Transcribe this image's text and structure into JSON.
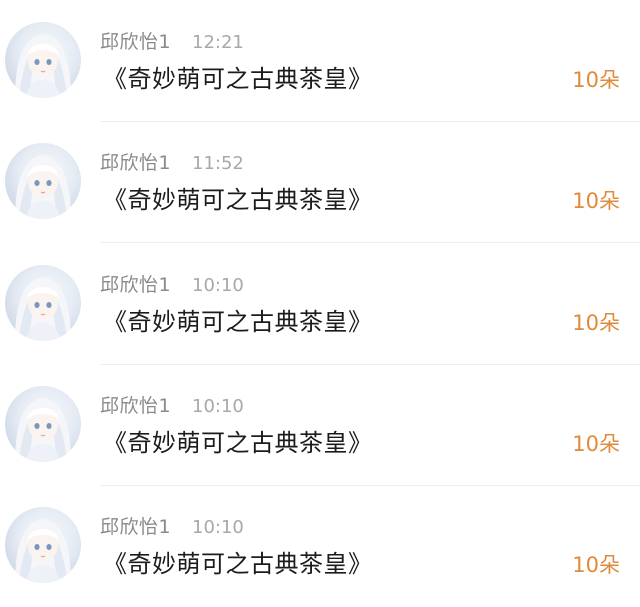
{
  "colors": {
    "name": "#8a8a8a",
    "time": "#a8a8a8",
    "title": "#1c1c1c",
    "amount": "#e08a3a",
    "divider": "#eeeeee"
  },
  "items": [
    {
      "avatar_icon": "anime-girl-avatar",
      "name": "邱欣怡1",
      "time": "12:21",
      "title": "《奇妙萌可之古典茶皇》",
      "amount": "10朵"
    },
    {
      "avatar_icon": "anime-girl-avatar",
      "name": "邱欣怡1",
      "time": "11:52",
      "title": "《奇妙萌可之古典茶皇》",
      "amount": "10朵"
    },
    {
      "avatar_icon": "anime-girl-avatar",
      "name": "邱欣怡1",
      "time": "10:10",
      "title": "《奇妙萌可之古典茶皇》",
      "amount": "10朵"
    },
    {
      "avatar_icon": "anime-girl-avatar",
      "name": "邱欣怡1",
      "time": "10:10",
      "title": "《奇妙萌可之古典茶皇》",
      "amount": "10朵"
    },
    {
      "avatar_icon": "anime-girl-avatar",
      "name": "邱欣怡1",
      "time": "10:10",
      "title": "《奇妙萌可之古典茶皇》",
      "amount": "10朵"
    }
  ]
}
